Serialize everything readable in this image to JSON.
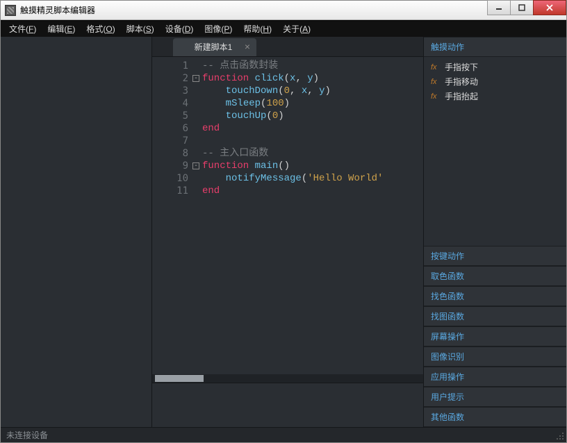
{
  "window": {
    "title": "触摸精灵脚本编辑器"
  },
  "menu": {
    "items": [
      {
        "label": "文件",
        "accel": "F"
      },
      {
        "label": "编辑",
        "accel": "E"
      },
      {
        "label": "格式",
        "accel": "O"
      },
      {
        "label": "脚本",
        "accel": "S"
      },
      {
        "label": "设备",
        "accel": "D"
      },
      {
        "label": "图像",
        "accel": "P"
      },
      {
        "label": "帮助",
        "accel": "H"
      },
      {
        "label": "关于",
        "accel": "A"
      }
    ]
  },
  "tabs": [
    {
      "label": "新建脚本1"
    }
  ],
  "code": {
    "lines": [
      {
        "n": "1",
        "tokens": [
          [
            "comment",
            "-- 点击函数封装"
          ]
        ]
      },
      {
        "n": "2",
        "fold": true,
        "tokens": [
          [
            "keyword",
            "function"
          ],
          [
            "plain",
            " "
          ],
          [
            "func",
            "click"
          ],
          [
            "paren",
            "("
          ],
          [
            "ident",
            "x"
          ],
          [
            "paren",
            ", "
          ],
          [
            "ident",
            "y"
          ],
          [
            "paren",
            ")"
          ]
        ]
      },
      {
        "n": "3",
        "tokens": [
          [
            "plain",
            "    "
          ],
          [
            "func",
            "touchDown"
          ],
          [
            "paren",
            "("
          ],
          [
            "num",
            "0"
          ],
          [
            "paren",
            ", "
          ],
          [
            "ident",
            "x"
          ],
          [
            "paren",
            ", "
          ],
          [
            "ident",
            "y"
          ],
          [
            "paren",
            ")"
          ]
        ]
      },
      {
        "n": "4",
        "tokens": [
          [
            "plain",
            "    "
          ],
          [
            "func",
            "mSleep"
          ],
          [
            "paren",
            "("
          ],
          [
            "num",
            "100"
          ],
          [
            "paren",
            ")"
          ]
        ]
      },
      {
        "n": "5",
        "tokens": [
          [
            "plain",
            "    "
          ],
          [
            "func",
            "touchUp"
          ],
          [
            "paren",
            "("
          ],
          [
            "num",
            "0"
          ],
          [
            "paren",
            ")"
          ]
        ]
      },
      {
        "n": "6",
        "tokens": [
          [
            "keyword",
            "end"
          ]
        ]
      },
      {
        "n": "7",
        "tokens": []
      },
      {
        "n": "8",
        "tokens": [
          [
            "comment",
            "-- 主入口函数"
          ]
        ]
      },
      {
        "n": "9",
        "fold": true,
        "tokens": [
          [
            "keyword",
            "function"
          ],
          [
            "plain",
            " "
          ],
          [
            "func",
            "main"
          ],
          [
            "paren",
            "()"
          ]
        ]
      },
      {
        "n": "10",
        "tokens": [
          [
            "plain",
            "    "
          ],
          [
            "func",
            "notifyMessage"
          ],
          [
            "paren",
            "("
          ],
          [
            "str",
            "'Hello World'"
          ]
        ]
      },
      {
        "n": "11",
        "tokens": [
          [
            "keyword",
            "end"
          ]
        ]
      }
    ]
  },
  "right": {
    "sections": [
      {
        "title": "触摸动作",
        "expanded": true,
        "items": [
          "手指按下",
          "手指移动",
          "手指抬起"
        ]
      },
      {
        "title": "按键动作",
        "expanded": false
      },
      {
        "title": "取色函数",
        "expanded": false
      },
      {
        "title": "找色函数",
        "expanded": false
      },
      {
        "title": "找图函数",
        "expanded": false
      },
      {
        "title": "屏幕操作",
        "expanded": false
      },
      {
        "title": "图像识别",
        "expanded": false
      },
      {
        "title": "应用操作",
        "expanded": false
      },
      {
        "title": "用户提示",
        "expanded": false
      },
      {
        "title": "其他函数",
        "expanded": false
      }
    ]
  },
  "status": {
    "text": "未连接设备"
  }
}
